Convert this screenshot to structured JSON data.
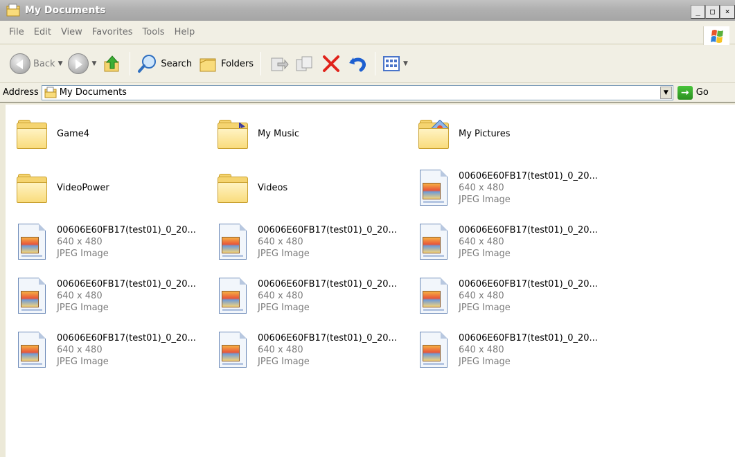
{
  "window": {
    "title": "My Documents",
    "controls": [
      "_",
      "□",
      "×"
    ]
  },
  "menu": [
    "File",
    "Edit",
    "View",
    "Favorites",
    "Tools",
    "Help"
  ],
  "toolbar": {
    "back_label": "Back",
    "search_label": "Search",
    "folders_label": "Folders"
  },
  "address": {
    "label": "Address",
    "value": "My Documents",
    "go_label": "Go"
  },
  "items": [
    {
      "name": "Game4",
      "type": "folder"
    },
    {
      "name": "My Music",
      "type": "folder-music"
    },
    {
      "name": "My Pictures",
      "type": "folder-pictures"
    },
    {
      "name": "VideoPower",
      "type": "folder"
    },
    {
      "name": "Videos",
      "type": "folder"
    },
    {
      "name": "00606E60FB17(test01)_0_20...",
      "dims": "640 x 480",
      "kind": "JPEG Image",
      "type": "jpeg"
    },
    {
      "name": "00606E60FB17(test01)_0_20...",
      "dims": "640 x 480",
      "kind": "JPEG Image",
      "type": "jpeg"
    },
    {
      "name": "00606E60FB17(test01)_0_20...",
      "dims": "640 x 480",
      "kind": "JPEG Image",
      "type": "jpeg"
    },
    {
      "name": "00606E60FB17(test01)_0_20...",
      "dims": "640 x 480",
      "kind": "JPEG Image",
      "type": "jpeg"
    },
    {
      "name": "00606E60FB17(test01)_0_20...",
      "dims": "640 x 480",
      "kind": "JPEG Image",
      "type": "jpeg"
    },
    {
      "name": "00606E60FB17(test01)_0_20...",
      "dims": "640 x 480",
      "kind": "JPEG Image",
      "type": "jpeg"
    },
    {
      "name": "00606E60FB17(test01)_0_20...",
      "dims": "640 x 480",
      "kind": "JPEG Image",
      "type": "jpeg"
    },
    {
      "name": "00606E60FB17(test01)_0_20...",
      "dims": "640 x 480",
      "kind": "JPEG Image",
      "type": "jpeg"
    },
    {
      "name": "00606E60FB17(test01)_0_20...",
      "dims": "640 x 480",
      "kind": "JPEG Image",
      "type": "jpeg"
    },
    {
      "name": "00606E60FB17(test01)_0_20...",
      "dims": "640 x 480",
      "kind": "JPEG Image",
      "type": "jpeg"
    }
  ]
}
